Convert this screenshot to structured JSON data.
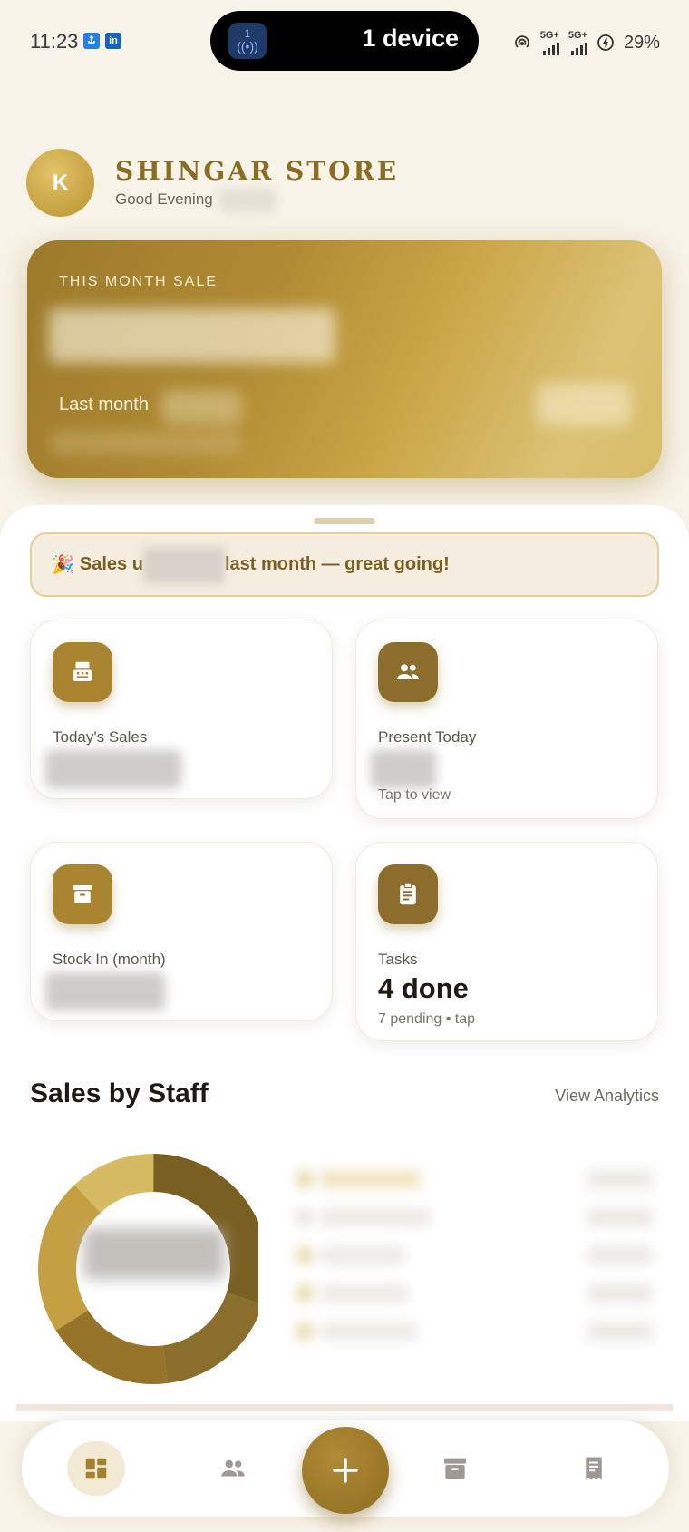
{
  "status_bar": {
    "time": "11:23",
    "island_badge_number": "1",
    "island_text": "1 device",
    "network_1": "5G+",
    "network_2": "5G+",
    "battery": "29%"
  },
  "header": {
    "avatar_initial": "K",
    "store_name": "SHINGAR STORE",
    "greeting": "Good Evening"
  },
  "sale_card": {
    "label": "THIS MONTH SALE",
    "last_month_label": "Last month"
  },
  "banner": {
    "emoji": "🎉",
    "text_start": "Sales u",
    "text_end": "last month — great going!"
  },
  "stats": {
    "todays_sales": {
      "label": "Today's Sales"
    },
    "present_today": {
      "label": "Present Today",
      "sub": "Tap to view"
    },
    "stock_in": {
      "label": "Stock In (month)"
    },
    "tasks": {
      "label": "Tasks",
      "value": "4 done",
      "sub": "7 pending • tap"
    }
  },
  "staff_section": {
    "title": "Sales by Staff",
    "link": "View Analytics"
  },
  "donut": {
    "segments": [
      {
        "fraction": 0.3,
        "color": "#7a5f22"
      },
      {
        "fraction": 0.18,
        "color": "#8a6e2c"
      },
      {
        "fraction": 0.18,
        "color": "#957329"
      },
      {
        "fraction": 0.22,
        "color": "#c4a043"
      },
      {
        "fraction": 0.12,
        "color": "#d7bb64"
      }
    ]
  },
  "colors": {
    "accent": "#8a6d22",
    "gold": "#b8922e",
    "background": "#f8f3e8"
  },
  "nav": {
    "items": [
      "dashboard-icon",
      "staff-icon",
      "add-icon",
      "stock-icon",
      "bills-icon"
    ]
  }
}
